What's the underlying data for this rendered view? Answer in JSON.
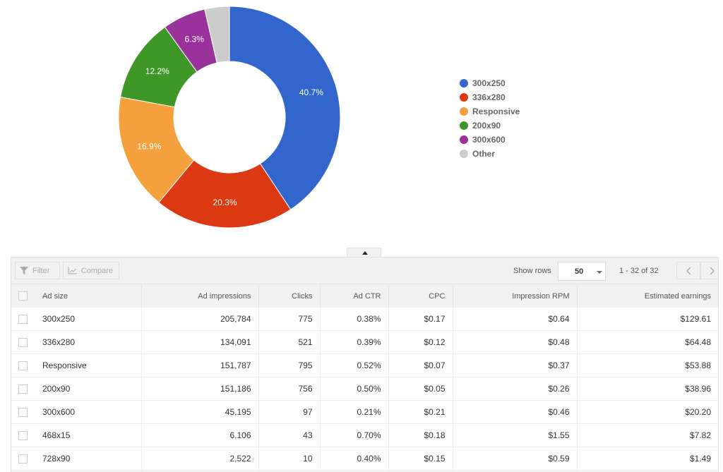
{
  "chart_data": {
    "type": "pie",
    "variant": "donut",
    "title": "",
    "slices": [
      {
        "label": "300x250",
        "value": 40.7,
        "color": "#3366cc",
        "label_text": "40.7%"
      },
      {
        "label": "336x280",
        "value": 20.3,
        "color": "#dc3912",
        "label_text": "20.3%"
      },
      {
        "label": "Responsive",
        "value": 16.9,
        "color": "#f4a03d",
        "label_text": "16.9%"
      },
      {
        "label": "200x90",
        "value": 12.2,
        "color": "#3f9728",
        "label_text": "12.2%"
      },
      {
        "label": "300x600",
        "value": 6.3,
        "color": "#99329a",
        "label_text": "6.3%"
      },
      {
        "label": "Other",
        "value": 3.6,
        "color": "#cccccc",
        "label_text": ""
      }
    ],
    "legend_position": "right"
  },
  "legend": [
    {
      "label": "300x250",
      "color": "#3366cc"
    },
    {
      "label": "336x280",
      "color": "#dc3912"
    },
    {
      "label": "Responsive",
      "color": "#f4a03d"
    },
    {
      "label": "200x90",
      "color": "#3f9728"
    },
    {
      "label": "300x600",
      "color": "#99329a"
    },
    {
      "label": "Other",
      "color": "#cccccc"
    }
  ],
  "toolbar": {
    "filter_label": "Filter",
    "compare_label": "Compare",
    "show_rows_label": "Show rows",
    "rows_value": "50",
    "pager_text": "1 - 32 of 32"
  },
  "table": {
    "columns": [
      "Ad size",
      "Ad impressions",
      "Clicks",
      "Ad CTR",
      "CPC",
      "Impression RPM",
      "Estimated earnings"
    ],
    "rows": [
      [
        "300x250",
        "205,784",
        "775",
        "0.38%",
        "$0.17",
        "$0.64",
        "$129.61"
      ],
      [
        "336x280",
        "134,091",
        "521",
        "0.39%",
        "$0.12",
        "$0.48",
        "$64.48"
      ],
      [
        "Responsive",
        "151,787",
        "795",
        "0.52%",
        "$0.07",
        "$0.37",
        "$53.88"
      ],
      [
        "200x90",
        "151,186",
        "756",
        "0.50%",
        "$0.05",
        "$0.26",
        "$38.96"
      ],
      [
        "300x600",
        "45,195",
        "97",
        "0.21%",
        "$0.21",
        "$0.46",
        "$20.20"
      ],
      [
        "468x15",
        "6,106",
        "43",
        "0.70%",
        "$0.18",
        "$1.55",
        "$7.82"
      ],
      [
        "728x90",
        "2,522",
        "10",
        "0.40%",
        "$0.15",
        "$0.59",
        "$1.49"
      ]
    ]
  }
}
